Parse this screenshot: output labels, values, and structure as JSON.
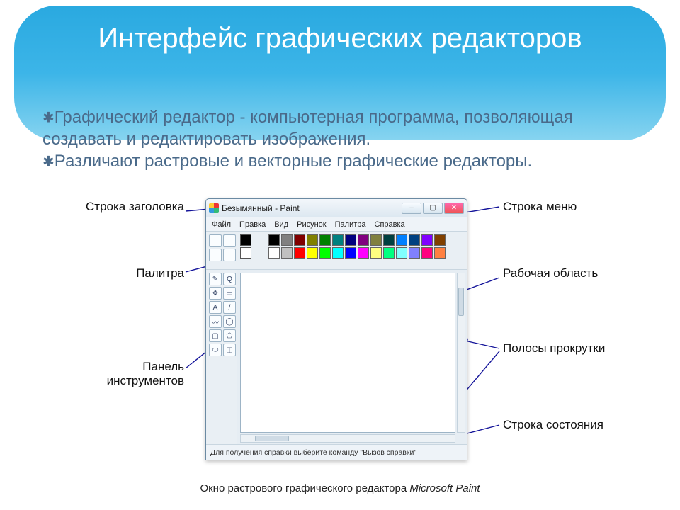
{
  "title": "Интерфейс графических редакторов",
  "description": {
    "line1_bullet": "✱",
    "line1": "Графический редактор - компьютерная программа, позволяющая создавать и редактировать изображения.",
    "line2_bullet": "✱",
    "line2": "Различают растровые и векторные графические редакторы."
  },
  "labels": {
    "title_bar": "Строка заголовка",
    "menu_bar": "Строка меню",
    "palette": "Палитра",
    "work_area": "Рабочая область",
    "tools_panel": "Панель инструментов",
    "scrollbars": "Полосы прокрутки",
    "status_bar": "Строка состояния"
  },
  "paint": {
    "title": "Безымянный - Paint",
    "menus": [
      "Файл",
      "Правка",
      "Вид",
      "Рисунок",
      "Палитра",
      "Справка"
    ],
    "status": "Для получения справки выберите команду \"Вызов справки\"",
    "palette_colors": [
      "#000000",
      "#808080",
      "#800000",
      "#808000",
      "#008000",
      "#008080",
      "#000080",
      "#800080",
      "#808040",
      "#004040",
      "#0080ff",
      "#004080",
      "#8000ff",
      "#804000",
      "#ffffff",
      "#c0c0c0",
      "#ff0000",
      "#ffff00",
      "#00ff00",
      "#00ffff",
      "#0000ff",
      "#ff00ff",
      "#ffff80",
      "#00ff80",
      "#80ffff",
      "#8080ff",
      "#ff0080",
      "#ff8040"
    ],
    "tool_glyphs": [
      "✎",
      "Q",
      "✥",
      "▭",
      "A",
      "/",
      "〰",
      "◯",
      "▢",
      "⬠",
      "⬭",
      "◫"
    ]
  },
  "caption_prefix": "Окно растрового графического редактора ",
  "caption_app": "Microsoft Paint"
}
